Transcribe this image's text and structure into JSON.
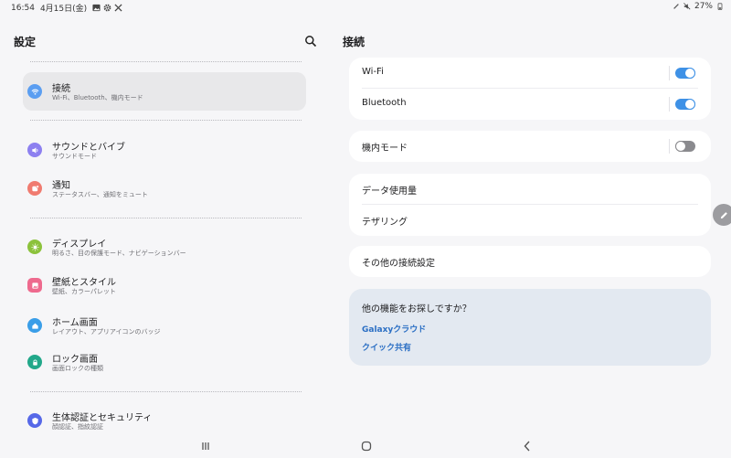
{
  "status_bar": {
    "time": "16:54",
    "date": "4月15日(金)",
    "left_icons": [
      "gallery-icon",
      "gear-icon",
      "tools-icon"
    ],
    "right_icons": [
      "pen-icon",
      "mute-icon"
    ],
    "battery": "27%"
  },
  "left": {
    "title": "設定",
    "items": [
      {
        "label": "接続",
        "sub": "Wi-Fi、Bluetooth、機内モード",
        "icon": "wifi-icon",
        "color": "#5b9ef1"
      },
      {
        "label": "サウンドとバイブ",
        "sub": "サウンドモード",
        "icon": "speaker-icon",
        "color": "#8d80f0"
      },
      {
        "label": "通知",
        "sub": "ステータスバー、通知をミュート",
        "icon": "notification-icon",
        "color": "#f07b70"
      },
      {
        "label": "ディスプレイ",
        "sub": "明るさ、目の保護モード、ナビゲーションバー",
        "icon": "sun-icon",
        "color": "#8cc23c"
      },
      {
        "label": "壁紙とスタイル",
        "sub": "壁紙、カラーパレット",
        "icon": "image-icon",
        "color": "#ee6a8e"
      },
      {
        "label": "ホーム画面",
        "sub": "レイアウト、アプリアイコンのバッジ",
        "icon": "home-icon",
        "color": "#3a9ee8"
      },
      {
        "label": "ロック画面",
        "sub": "画面ロックの種類",
        "icon": "lock-icon",
        "color": "#22a88a"
      },
      {
        "label": "生体認証とセキュリティ",
        "sub": "顔認証、指紋認証",
        "icon": "shield-icon",
        "color": "#5668e8"
      }
    ]
  },
  "right": {
    "title": "接続",
    "wifi": {
      "label": "Wi-Fi",
      "on": true
    },
    "bluetooth": {
      "label": "Bluetooth",
      "on": true
    },
    "airplane": {
      "label": "機内モード",
      "on": false
    },
    "data_usage": "データ使用量",
    "tethering": "テザリング",
    "more": "その他の接続設定",
    "suggest": {
      "question": "他の機能をお探しですか？",
      "link1": "Galaxyクラウド",
      "link2": "クイック共有"
    }
  },
  "colors": {
    "accent": "#3e91e6",
    "link": "#2b6fc4",
    "background": "#f6f6f8"
  }
}
